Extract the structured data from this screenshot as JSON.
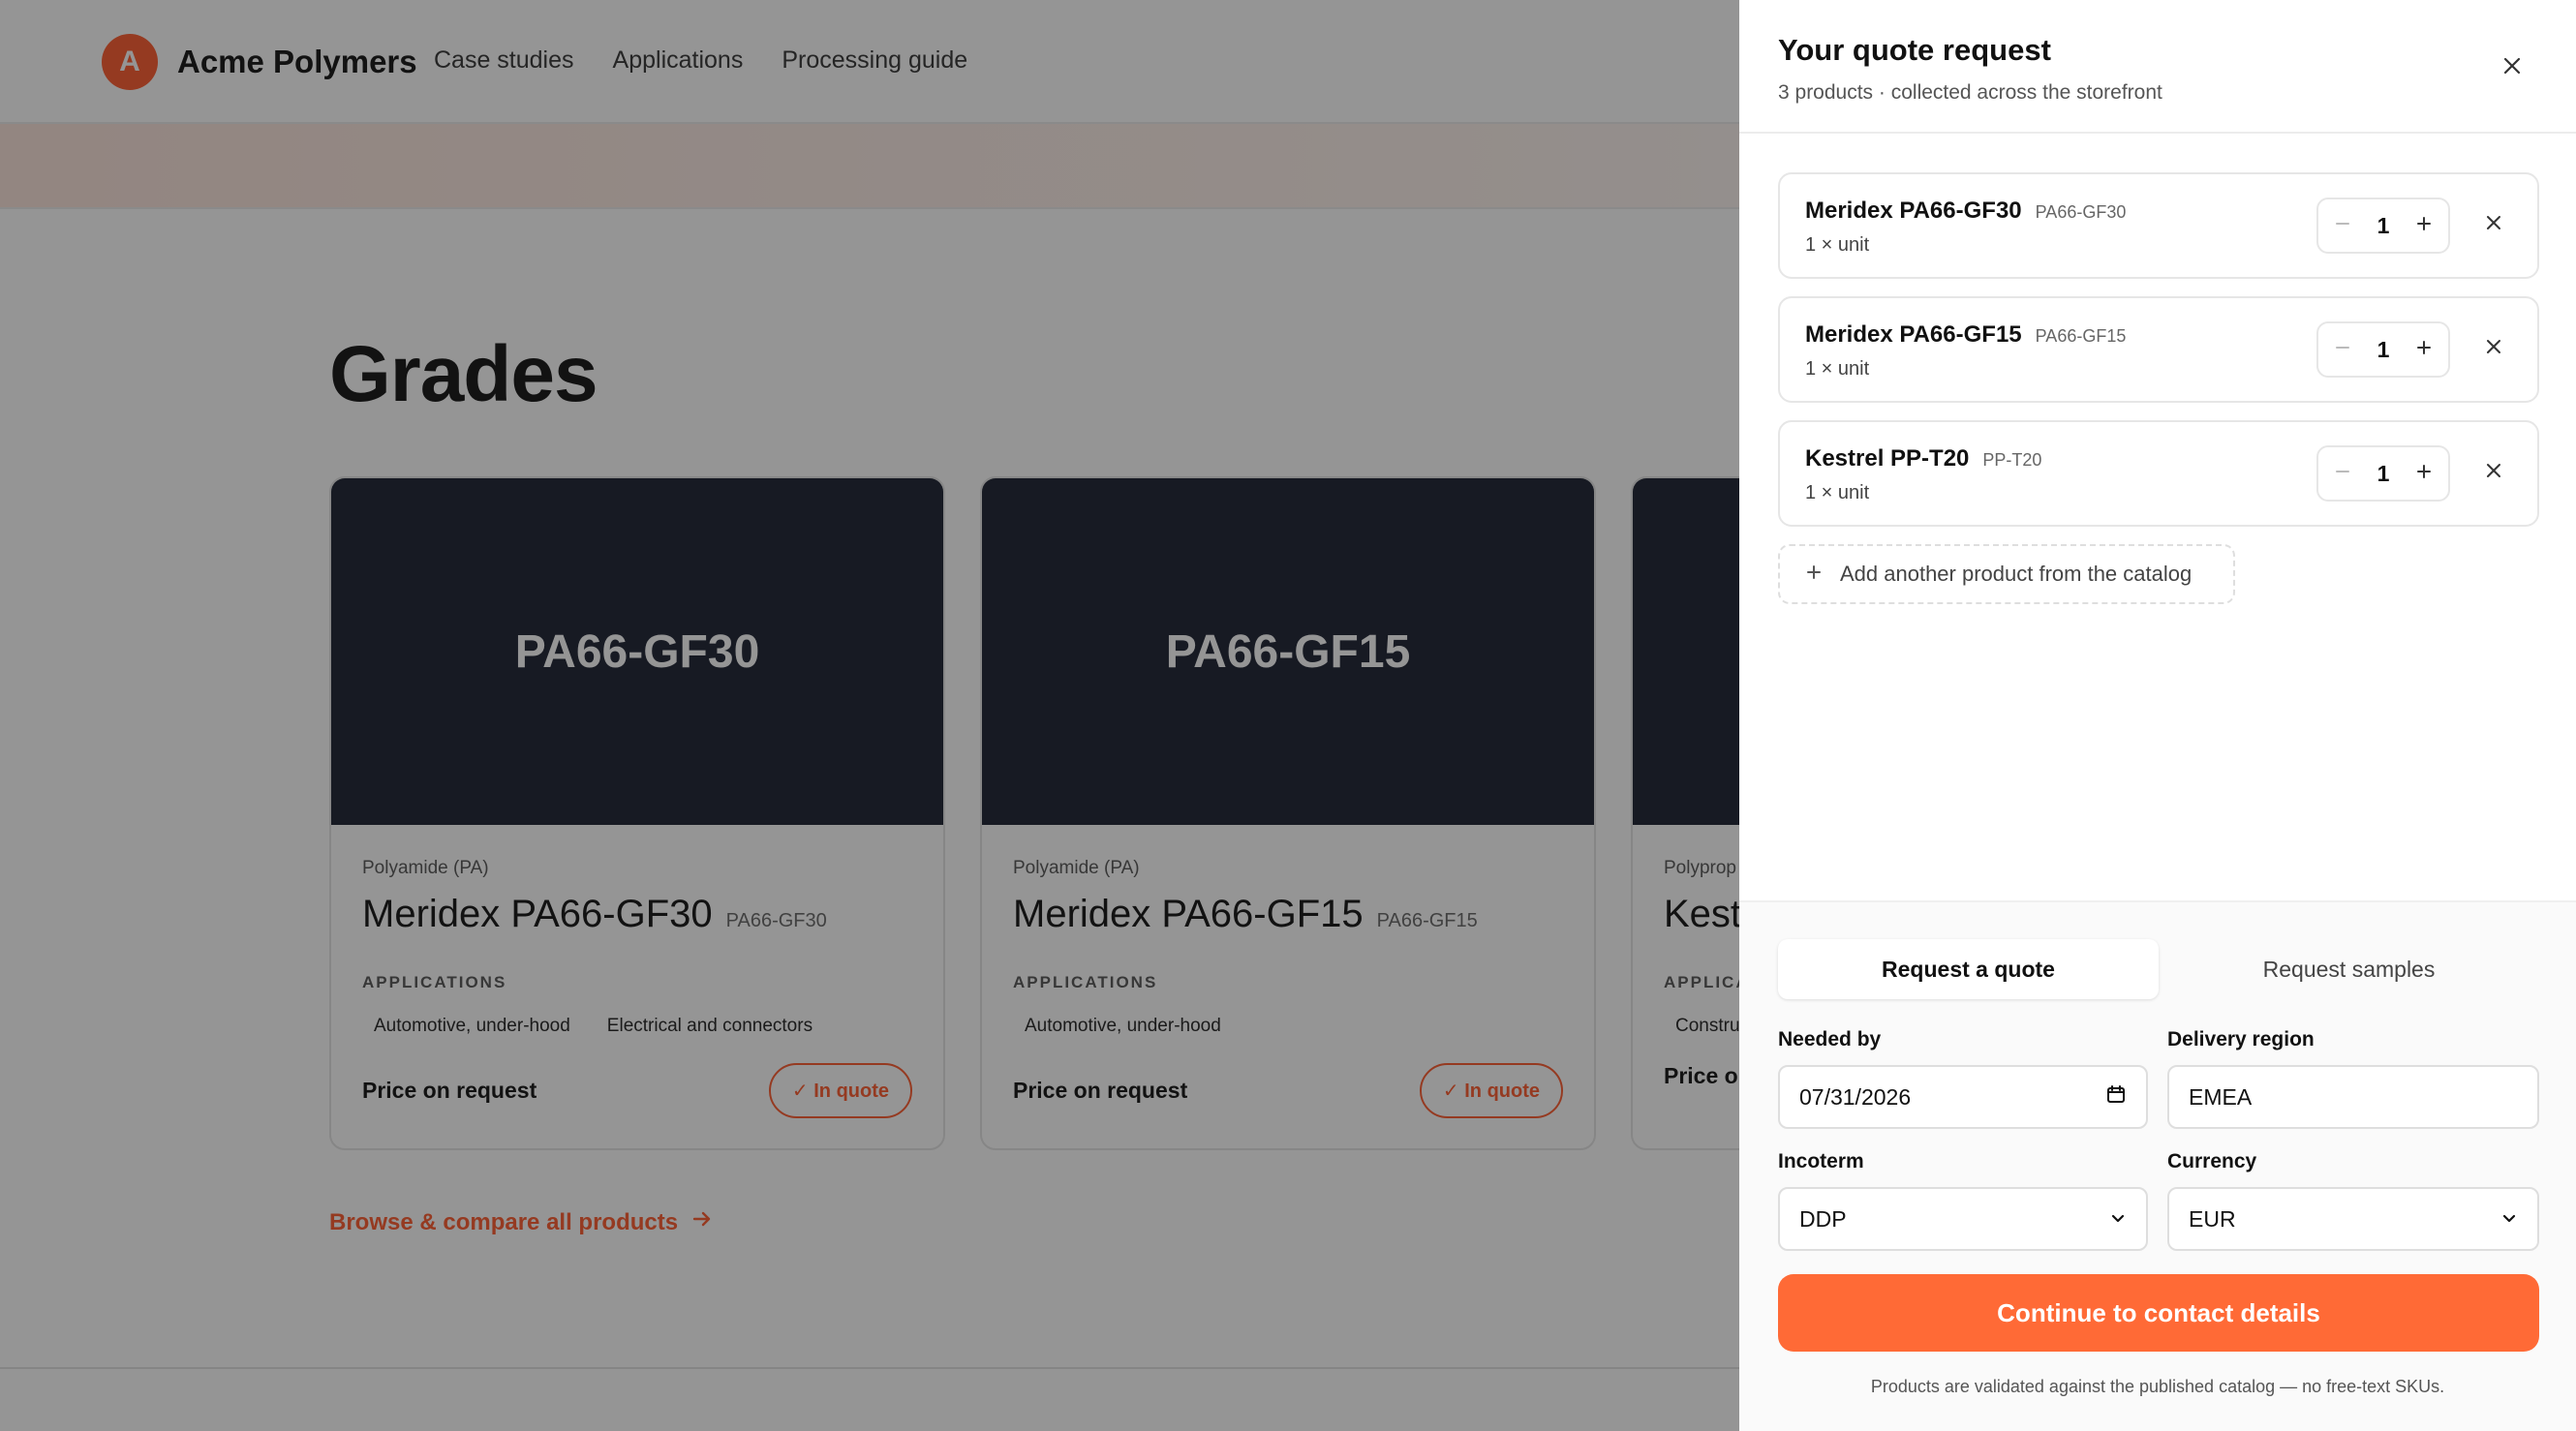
{
  "brand": {
    "logo_letter": "A",
    "name": "Acme Polymers"
  },
  "nav": [
    "Case studies",
    "Applications",
    "Processing guide"
  ],
  "section_title": "Grades",
  "cards": [
    {
      "media_label": "PA66-GF30",
      "family": "Polyamide (PA)",
      "name": "Meridex PA66-GF30",
      "sku": "PA66-GF30",
      "apps_label": "APPLICATIONS",
      "apps": [
        "Automotive, under-hood",
        "Electrical and connectors"
      ],
      "price": "Price on request",
      "quote_badge": "✓ In quote"
    },
    {
      "media_label": "PA66-GF15",
      "family": "Polyamide (PA)",
      "name": "Meridex PA66-GF15",
      "sku": "PA66-GF15",
      "apps_label": "APPLICATIONS",
      "apps": [
        "Automotive, under-hood"
      ],
      "price": "Price on request",
      "quote_badge": "✓ In quote"
    },
    {
      "media_label": "",
      "family": "Polyprop",
      "name": "Kest",
      "sku": "",
      "apps_label": "APPLICA",
      "apps": [
        "Constru"
      ],
      "price": "Price or",
      "quote_badge": ""
    }
  ],
  "browse_link": "Browse & compare all products",
  "drawer": {
    "title": "Your quote request",
    "subtitle": "3 products · collected across the storefront",
    "items": [
      {
        "name": "Meridex PA66-GF30",
        "sku": "PA66-GF30",
        "unit": "1 × unit",
        "qty": "1"
      },
      {
        "name": "Meridex PA66-GF15",
        "sku": "PA66-GF15",
        "unit": "1 × unit",
        "qty": "1"
      },
      {
        "name": "Kestrel PP-T20",
        "sku": "PP-T20",
        "unit": "1 × unit",
        "qty": "1"
      }
    ],
    "add_product": "Add another product from the catalog",
    "tabs": [
      "Request a quote",
      "Request samples"
    ],
    "active_tab": "Request a quote",
    "fields": {
      "needed_by": {
        "label": "Needed by",
        "value": "07/31/2026"
      },
      "delivery_region": {
        "label": "Delivery region",
        "value": "EMEA"
      },
      "incoterm": {
        "label": "Incoterm",
        "value": "DDP"
      },
      "currency": {
        "label": "Currency",
        "value": "EUR"
      }
    },
    "cta": "Continue to contact details",
    "disclaimer": "Products are validated against the published catalog — no free-text SKUs."
  },
  "colors": {
    "accent": "#ff5a2c",
    "cta": "#ff6a36",
    "card_media": "#1b2030"
  }
}
